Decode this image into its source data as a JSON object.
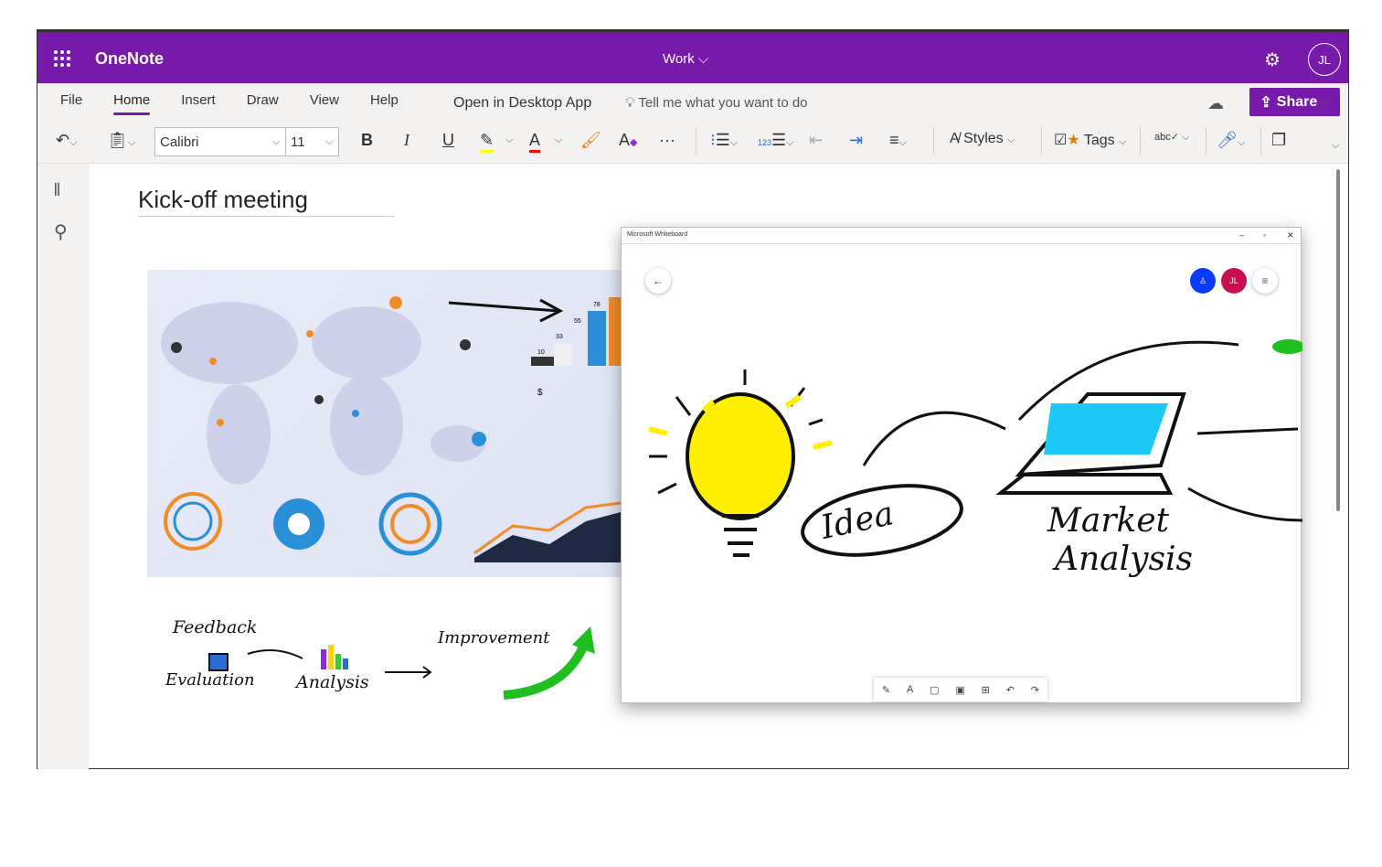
{
  "header": {
    "app_name": "OneNote",
    "notebook": "Work",
    "notebook_caret": "⌄",
    "settings_icon": "gear-icon",
    "avatar_initials": "JL"
  },
  "ribbon": {
    "tabs": [
      {
        "label": "File"
      },
      {
        "label": "Home",
        "active": true
      },
      {
        "label": "Insert"
      },
      {
        "label": "Draw"
      },
      {
        "label": "View"
      },
      {
        "label": "Help"
      }
    ],
    "open_desktop": "Open in Desktop App",
    "tell_me": "Tell me what you want to do",
    "share": "Share"
  },
  "toolbar": {
    "font": "Calibri",
    "font_size": "11",
    "bold": "B",
    "italic": "I",
    "underline": "U",
    "more": "···",
    "styles": "Styles",
    "tags": "Tags",
    "spell": "abc",
    "highlight_color": "#ffff00",
    "font_color": "#ff0000"
  },
  "page": {
    "title": "Kick-off meeting"
  },
  "collage": {
    "bar_labels": [
      "10",
      "33",
      "55",
      "78"
    ],
    "currency": "$"
  },
  "sketch": {
    "feedback": "Feedback",
    "evaluation": "Evaluation",
    "analysis": "Analysis",
    "improvement": "Improvement"
  },
  "whiteboard": {
    "window_title": "Microsoft Whiteboard",
    "avatar_initials": "JL",
    "idea": "Idea",
    "market": "Market",
    "analysis": "Analysis",
    "colors": {
      "user_blue": "#0a3cff",
      "user_red": "#c8104e"
    }
  },
  "colors": {
    "brand": "#7719aa"
  }
}
